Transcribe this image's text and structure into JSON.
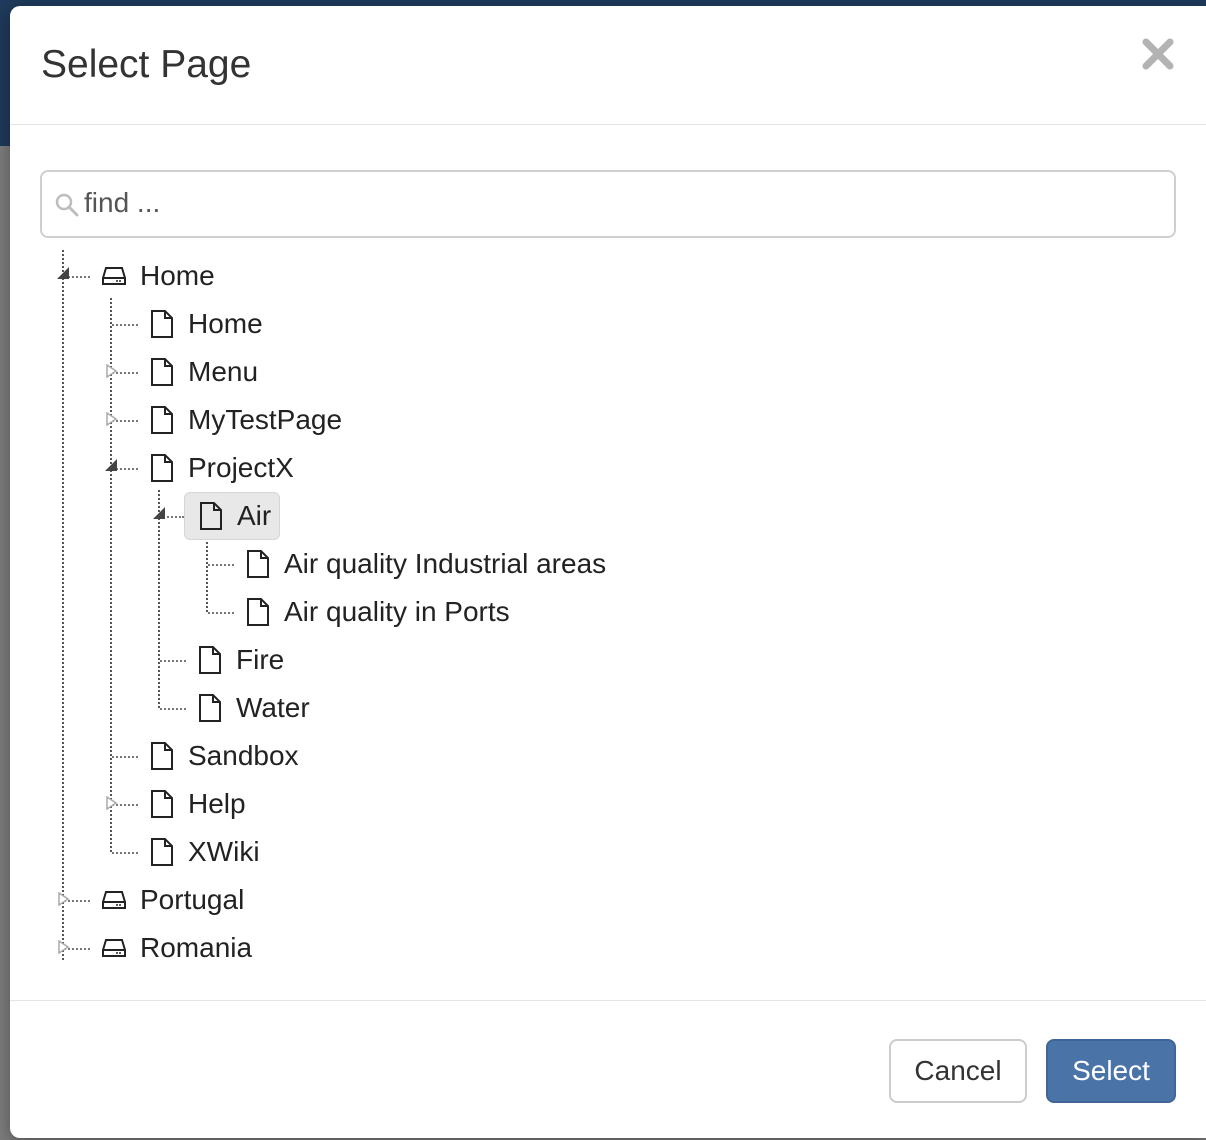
{
  "dialog": {
    "title": "Select Page",
    "close_icon": "close-icon"
  },
  "search": {
    "placeholder": "find ...",
    "value": "",
    "icon": "search-icon"
  },
  "tree": {
    "nodes": [
      {
        "label": "Home",
        "icon": "drive-icon",
        "state": "expanded"
      },
      {
        "label": "Home",
        "icon": "page-icon",
        "state": "leaf"
      },
      {
        "label": "Menu",
        "icon": "page-icon",
        "state": "collapsed"
      },
      {
        "label": "MyTestPage",
        "icon": "page-icon",
        "state": "collapsed"
      },
      {
        "label": "ProjectX",
        "icon": "page-icon",
        "state": "expanded"
      },
      {
        "label": "Air",
        "icon": "page-icon",
        "state": "expanded",
        "selected": true
      },
      {
        "label": "Air quality Industrial areas",
        "icon": "page-icon",
        "state": "leaf"
      },
      {
        "label": "Air quality in Ports",
        "icon": "page-icon",
        "state": "leaf"
      },
      {
        "label": "Fire",
        "icon": "page-icon",
        "state": "leaf"
      },
      {
        "label": "Water",
        "icon": "page-icon",
        "state": "leaf"
      },
      {
        "label": "Sandbox",
        "icon": "page-icon",
        "state": "leaf"
      },
      {
        "label": "Help",
        "icon": "page-icon",
        "state": "collapsed"
      },
      {
        "label": "XWiki",
        "icon": "page-icon",
        "state": "leaf"
      },
      {
        "label": "Portugal",
        "icon": "drive-icon",
        "state": "collapsed"
      },
      {
        "label": "Romania",
        "icon": "drive-icon",
        "state": "collapsed"
      }
    ]
  },
  "footer": {
    "cancel_label": "Cancel",
    "select_label": "Select"
  },
  "colors": {
    "primary": "#4a74a8",
    "selected_bg": "#e8e8e8",
    "title_text": "#333333"
  }
}
